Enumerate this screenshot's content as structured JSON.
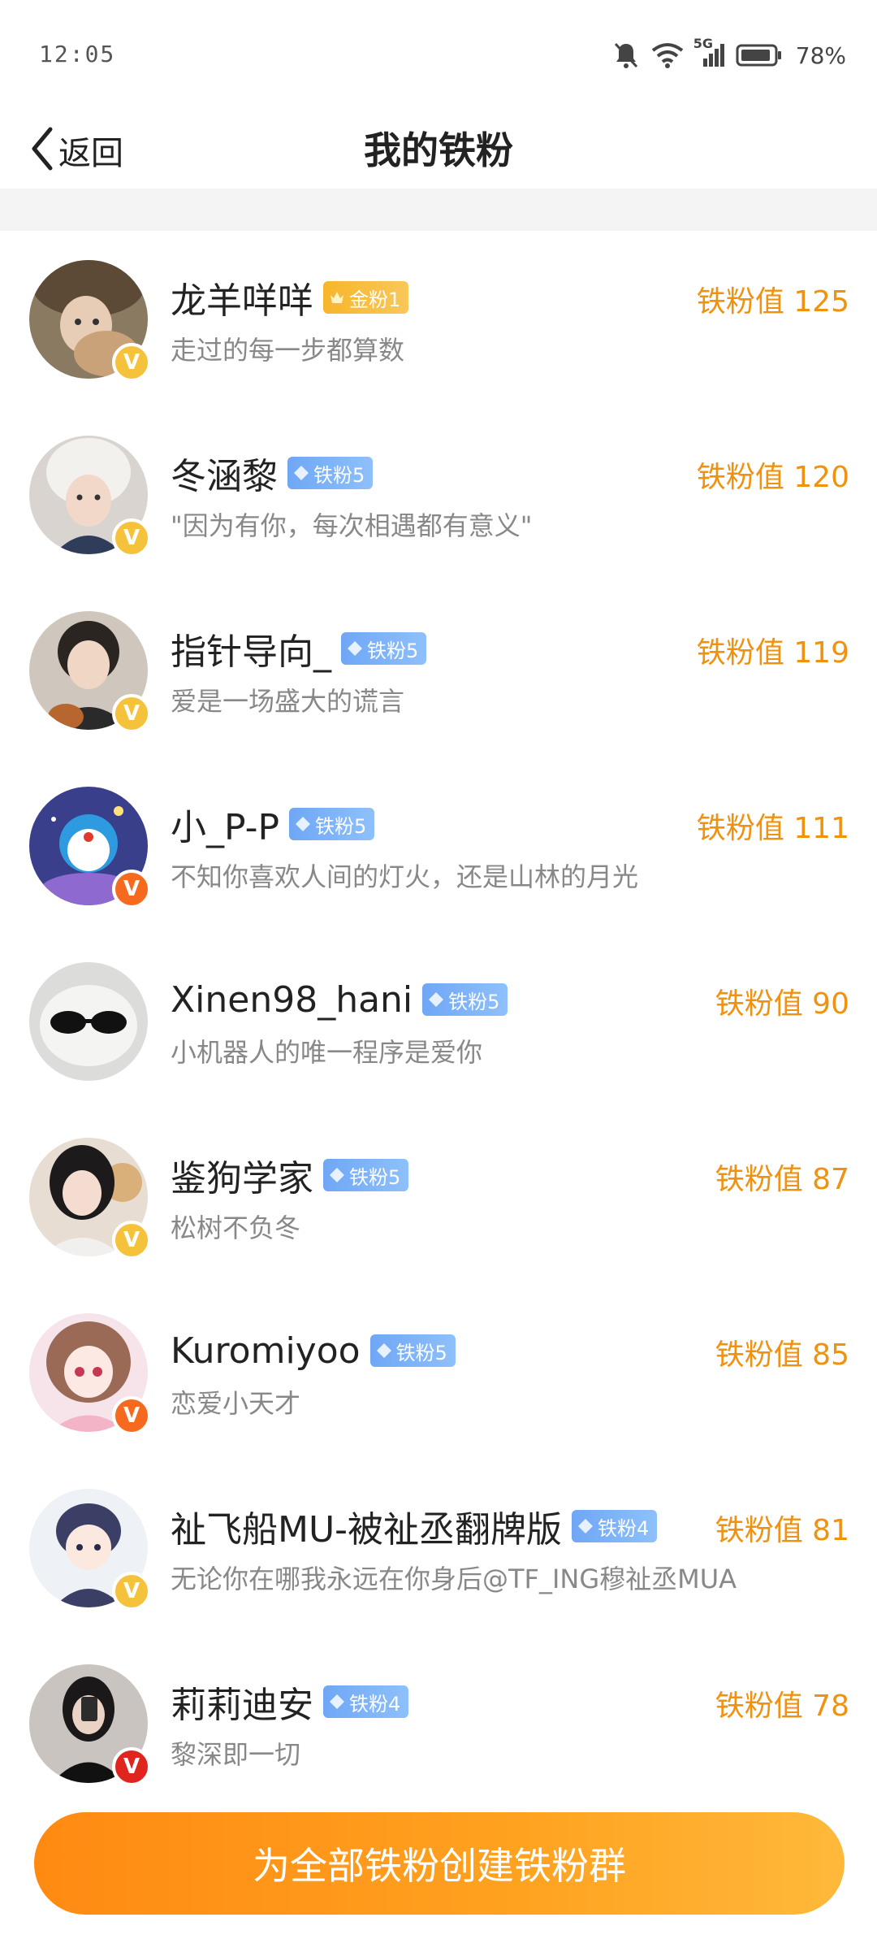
{
  "status_bar": {
    "time": "12:05",
    "network": "5G",
    "battery": "78%"
  },
  "header": {
    "back_label": "返回",
    "title": "我的铁粉"
  },
  "fans": [
    {
      "name": "龙羊咩咩",
      "badge": "金粉1",
      "badge_type": "gold",
      "sign": "走过的每一步都算数",
      "score": "铁粉值 125",
      "v_color": "yellow"
    },
    {
      "name": "冬涵黎",
      "badge": "铁粉5",
      "badge_type": "iron",
      "sign": "\"因为有你，每次相遇都有意义\"",
      "score": "铁粉值 120",
      "v_color": "yellow"
    },
    {
      "name": "指针导向_",
      "badge": "铁粉5",
      "badge_type": "iron",
      "sign": "爱是一场盛大的谎言",
      "score": "铁粉值 119",
      "v_color": "yellow"
    },
    {
      "name": "小_P-P",
      "badge": "铁粉5",
      "badge_type": "iron",
      "sign": "不知你喜欢人间的灯火，还是山林的月光",
      "score": "铁粉值 111",
      "v_color": "orange"
    },
    {
      "name": "Xinen98_hani",
      "badge": "铁粉5",
      "badge_type": "iron",
      "sign": "小机器人的唯一程序是爱你",
      "score": "铁粉值 90",
      "v_color": "none"
    },
    {
      "name": "鉴狗学家",
      "badge": "铁粉5",
      "badge_type": "iron",
      "sign": "松树不负冬",
      "score": "铁粉值 87",
      "v_color": "yellow"
    },
    {
      "name": "Kuromiyoo",
      "badge": "铁粉5",
      "badge_type": "iron",
      "sign": "恋爱小天才",
      "score": "铁粉值 85",
      "v_color": "orange"
    },
    {
      "name": "祉飞船MU-被祉丞翻牌版",
      "badge": "铁粉4",
      "badge_type": "iron",
      "sign": "无论你在哪我永远在你身后@TF_ING穆祉丞MUA",
      "score": "铁粉值 81",
      "v_color": "yellow"
    },
    {
      "name": "莉莉迪安",
      "badge": "铁粉4",
      "badge_type": "iron",
      "sign": "黎深即一切",
      "score": "铁粉值 78",
      "v_color": "red"
    }
  ],
  "bottom": {
    "create_button": "为全部铁粉创建铁粉群"
  },
  "colors": {
    "accent": "#f0920f",
    "button": "#ff9a1a",
    "iron_badge": "#7ab3f7",
    "gold_badge": "#f7b52a"
  }
}
